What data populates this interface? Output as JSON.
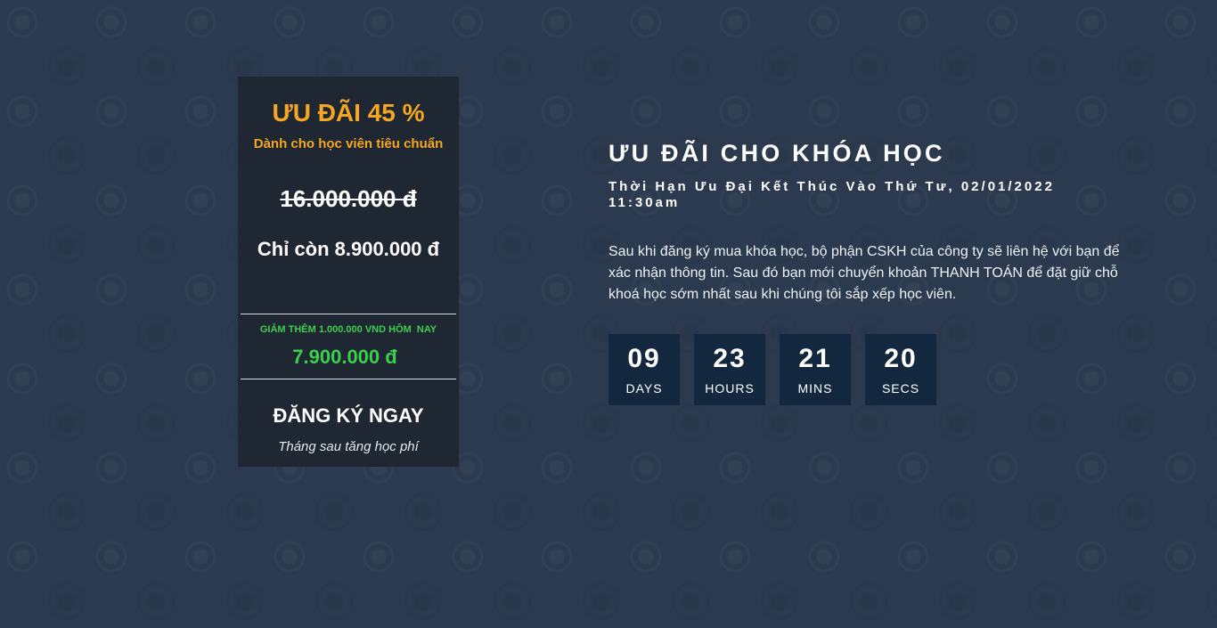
{
  "offer_card": {
    "title": "ƯU ĐÃI 45 %",
    "subtitle": "Dành cho học viên tiêu chuẩn",
    "original_price": "16.000.000 đ",
    "discounted_price": "Chỉ còn 8.900.000 đ",
    "extra_discount_label": "GIẢM THÊM 1.000.000 VND HÔM  NAY",
    "extra_discount_price": "7.900.000 đ",
    "register_label": "ĐĂNG KÝ NGAY",
    "note": "Tháng sau tăng học phí"
  },
  "promo": {
    "headline": "ƯU ĐÃI CHO KHÓA HỌC",
    "deadline": "Thời Hạn Ưu Đại Kết Thúc Vào Thứ Tư, 02/01/2022 11:30am",
    "description": "Sau khi đăng ký mua khóa học, bộ phận CSKH của công ty sẽ liên hệ với bạn để xác nhận thông tin. Sau đó bạn mới chuyển khoản THANH TOÁN để đặt giữ chỗ khoá học sớm nhất sau khi chúng tôi sắp xếp học viên."
  },
  "countdown": [
    {
      "value": "09",
      "label": "DAYS"
    },
    {
      "value": "23",
      "label": "HOURS"
    },
    {
      "value": "21",
      "label": "MINS"
    },
    {
      "value": "20",
      "label": "SECS"
    }
  ],
  "colors": {
    "background": "#2b3a4e",
    "card": "#1f2733",
    "accent_orange": "#f5a623",
    "accent_green": "#3ccf4e",
    "countdown_box": "#13283f"
  }
}
